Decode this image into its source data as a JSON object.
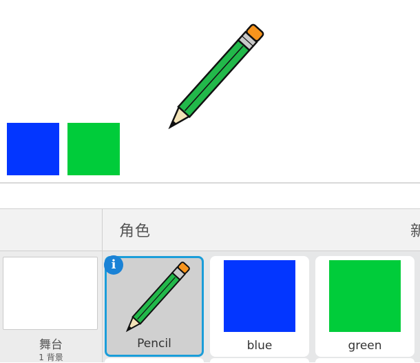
{
  "stage": {
    "sprites": [
      {
        "name": "Pencil",
        "icon": "pencil-icon"
      },
      {
        "name": "blue",
        "color": "#0336ff"
      },
      {
        "name": "green",
        "color": "#00cc3a"
      }
    ]
  },
  "stage_panel": {
    "label": "舞台",
    "sub_label": "1 背景"
  },
  "sprites_panel": {
    "title": "角色",
    "new_label_partial": "新",
    "tiles": [
      {
        "label": "Pencil",
        "selected": true,
        "info_icon": "i"
      },
      {
        "label": "blue",
        "color": "#0336ff"
      },
      {
        "label": "green",
        "color": "#00cc3a"
      }
    ]
  },
  "colors": {
    "selection": "#1a9dd9",
    "pencil_body": "#22b84a",
    "pencil_eraser": "#f7941d"
  }
}
